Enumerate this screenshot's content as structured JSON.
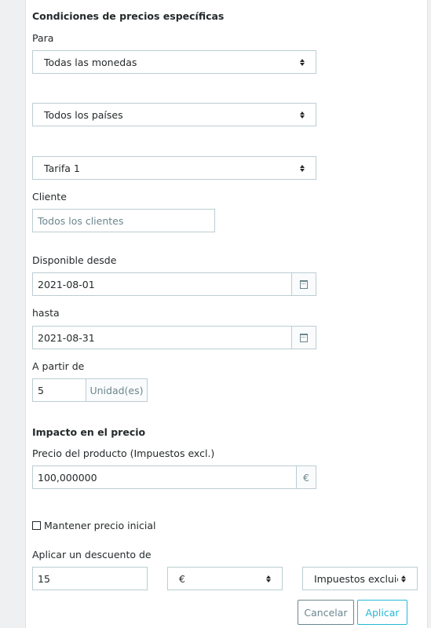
{
  "section_title": "Condiciones de precios específicas",
  "for_label": "Para",
  "currency_select": "Todas las monedas",
  "country_select": "Todos los países",
  "group_select": "Tarifa 1",
  "customer_label": "Cliente",
  "customer_placeholder": "Todos los clientes",
  "from_label": "Disponible desde",
  "from_value": "2021-08-01",
  "to_label": "hasta",
  "to_value": "2021-08-31",
  "from_quantity_label": "A partir de",
  "from_quantity_value": "5",
  "quantity_unit": "Unidad(es)",
  "impact_title": "Impacto en el precio",
  "price_label": "Precio del producto (Impuestos excl.)",
  "price_value": "100,000000",
  "price_currency": "€",
  "keep_price_label": "Mantener precio inicial",
  "keep_price_checked": false,
  "discount_label": "Aplicar un descuento de",
  "discount_value": "15",
  "discount_type_select": "€",
  "discount_tax_select": "Impuestos excluidos",
  "cancel_label": "Cancelar",
  "apply_label": "Aplicar"
}
